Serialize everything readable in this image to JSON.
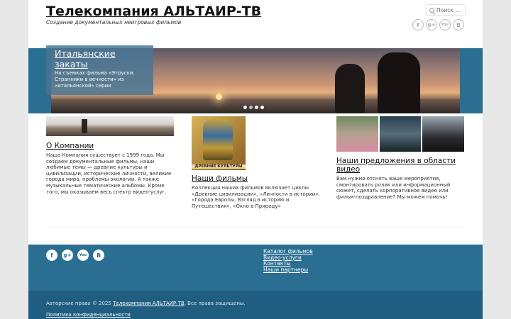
{
  "header": {
    "title": "Телекомпания АЛЬТАИР-ТВ",
    "description": "Создание документальных неигровых фильмов",
    "search_placeholder": "Поиск ...",
    "social": [
      {
        "icon": "facebook-icon",
        "glyph": "f"
      },
      {
        "icon": "googleplus-icon",
        "glyph": "g+"
      },
      {
        "icon": "youtube-icon",
        "glyph": "You"
      },
      {
        "icon": "vkontakte-icon",
        "glyph": "B"
      }
    ]
  },
  "slider": {
    "title": "Итальянские закаты",
    "text": "На съемках фильма «Этруски. Странники в вечности» из «итальянской» серии"
  },
  "columns": [
    {
      "title": "О Компании",
      "text": "Наша Компания существует с 1999 года. Мы создаем документальные фильмы, наши любимые темы — древние культуры и цивилизации, исторические личности, великие города мира, проблемы экологии. А также музыкальные тематические альбомы. Кроме того, мы оказываем весь спектр видео-услуг."
    },
    {
      "title": "Наши фильмы",
      "image_label": "ДРЕВНИЕ КУЛЬТУРЫ",
      "text": "Коллекция наших фильмов включает циклы «Древние цивилизации», «Личности в истории», «Города Европы. Взгляд в историю и Путешествия», «Окно в Природу»"
    },
    {
      "title": "Наши предложения в области видео",
      "text": "Вам нужно отснять ваше мероприятие, смонтировать ролик или информационный сюжет, сделать корпоративное видео или фильм-поздравление? Мы можем помочь!"
    }
  ],
  "footer": {
    "links": [
      "Каталог фильмов",
      "Видео-услуги",
      "Контакты",
      "Наши партнеры"
    ],
    "copyright_prefix": "Авторские права © 2025",
    "copyright_link": "Телекомпания АЛЬТАИР-ТВ",
    "copyright_suffix": ". Все права защищены.",
    "privacy": "Политика конфиденциальности"
  },
  "colors": {
    "accent": "#2a6e92",
    "footer_dark": "#1f5e80"
  }
}
